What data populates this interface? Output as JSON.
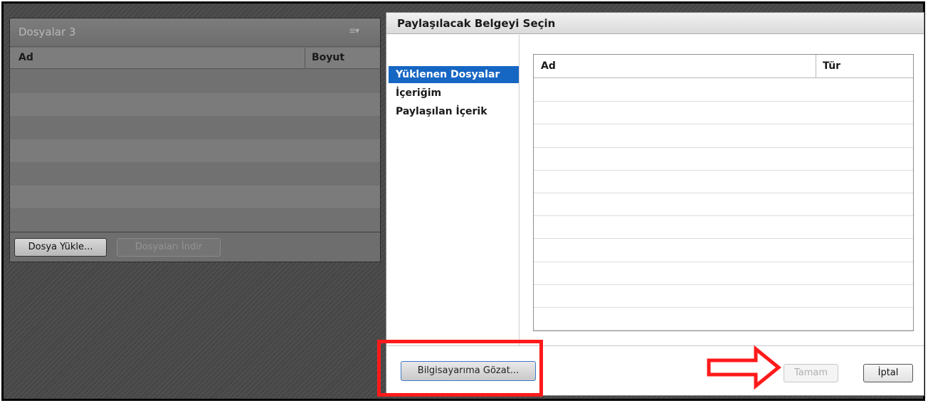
{
  "files_pod": {
    "title": "Dosyalar 3",
    "menu_icon": "≡▾",
    "columns": [
      "Ad",
      "Boyut"
    ],
    "rows": [
      "",
      "",
      "",
      "",
      "",
      "",
      ""
    ],
    "buttons": {
      "upload": "Dosya Yükle...",
      "download": "Dosyaları İndir"
    }
  },
  "dialog": {
    "title": "Paylaşılacak Belgeyi Seçin",
    "nav_items": [
      "Yüklenen Dosyalar",
      "İçeriğim",
      "Paylaşılan İçerik"
    ],
    "selected_nav_index": 0,
    "grid": {
      "columns": [
        "Ad",
        "Tür"
      ],
      "rows": [
        "",
        "",
        "",
        "",
        "",
        "",
        "",
        "",
        "",
        "",
        ""
      ]
    },
    "buttons": {
      "browse": "Bilgisayarıma Gözat...",
      "ok": "Tamam",
      "cancel": "İptal"
    }
  },
  "colors": {
    "selection": "#1666c4",
    "annotation": "#ff1a1a"
  }
}
